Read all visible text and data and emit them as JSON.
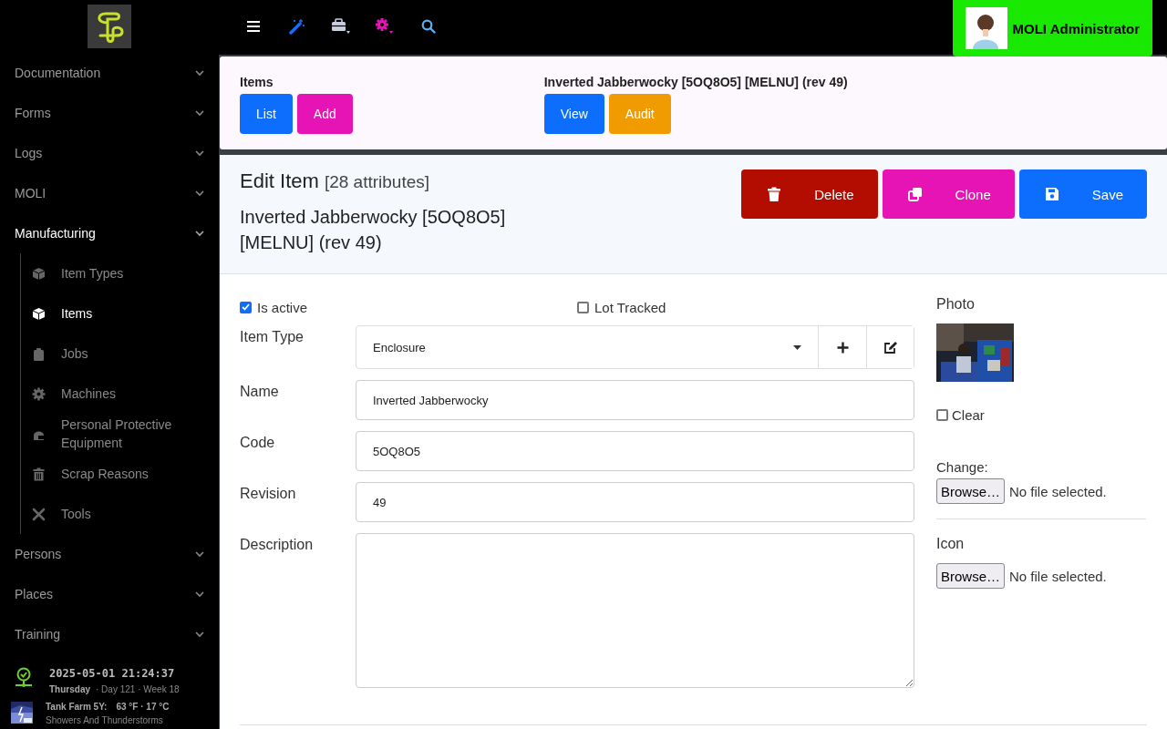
{
  "user": {
    "name": "MOLI Administrator"
  },
  "sidebar": {
    "items": [
      {
        "label": "Documentation",
        "expanded": false,
        "selected": false
      },
      {
        "label": "Forms",
        "expanded": false,
        "selected": false
      },
      {
        "label": "Logs",
        "expanded": false,
        "selected": false
      },
      {
        "label": "MOLI",
        "expanded": false,
        "selected": false
      },
      {
        "label": "Manufacturing",
        "expanded": true,
        "selected": true,
        "children": [
          {
            "label": "Item Types",
            "selected": false
          },
          {
            "label": "Items",
            "selected": true
          },
          {
            "label": "Jobs",
            "selected": false
          },
          {
            "label": "Machines",
            "selected": false
          },
          {
            "label": "Personal Protective Equipment",
            "selected": false
          },
          {
            "label": "Scrap Reasons",
            "selected": false
          },
          {
            "label": "Tools",
            "selected": false
          }
        ]
      },
      {
        "label": "Persons",
        "expanded": false,
        "selected": false
      },
      {
        "label": "Places",
        "expanded": false,
        "selected": false
      },
      {
        "label": "Training",
        "expanded": false,
        "selected": false
      }
    ]
  },
  "clock": {
    "datetime": "2025-05-01 21:24:37",
    "weekday": "Thursday",
    "details": "·  Day 121  ·  Week 18"
  },
  "weather": {
    "location": "Tank Farm 5Y:",
    "temperature": "63 °F · 17 °C",
    "condition": "Showers And Thunderstorms"
  },
  "nav_groups": [
    {
      "title": "Items",
      "buttons": [
        {
          "label": "List",
          "color": "#0d6efd"
        },
        {
          "label": "Add",
          "color": "#e614b4"
        }
      ]
    },
    {
      "title": "Inverted Jabberwocky [5OQ8O5] [MELNU] (rev 49)",
      "buttons": [
        {
          "label": "View",
          "color": "#0d6efd"
        },
        {
          "label": "Audit",
          "color": "#f09c00"
        }
      ]
    }
  ],
  "editor": {
    "title": "Edit Item",
    "count": "[28 attributes]",
    "subtitle": "Inverted Jabberwocky [5OQ8O5] [MELNU] (rev 49)",
    "actions": [
      {
        "label": "Delete",
        "color": "#b30c00"
      },
      {
        "label": "Clone",
        "color": "#e614b4"
      },
      {
        "label": "Save",
        "color": "#0d6efd"
      }
    ]
  },
  "checkboxes": [
    {
      "label": "Is active",
      "checked": true
    },
    {
      "label": "Lot Tracked",
      "checked": false
    }
  ],
  "fields": [
    {
      "label": "Item Type",
      "kind": "select",
      "value": "Enclosure"
    },
    {
      "label": "Name",
      "kind": "text",
      "value": "Inverted Jabberwocky"
    },
    {
      "label": "Code",
      "kind": "text",
      "value": "5OQ8O5"
    },
    {
      "label": "Revision",
      "kind": "text",
      "value": "49"
    },
    {
      "label": "Description",
      "kind": "textarea"
    }
  ],
  "photo": {
    "label": "Photo",
    "clear": {
      "label": "Clear",
      "checked": false
    },
    "change_label": "Change:",
    "file": {
      "button": "Browse…",
      "status": "No file selected."
    }
  },
  "icon_upload": {
    "label": "Icon",
    "file": {
      "button": "Browse…",
      "status": "No file selected."
    }
  }
}
